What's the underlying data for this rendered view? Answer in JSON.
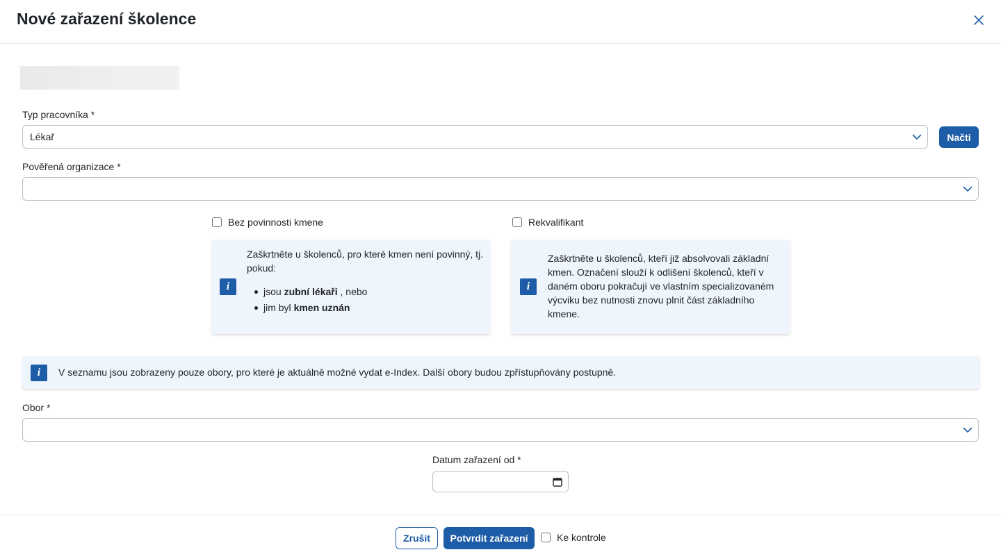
{
  "dialog": {
    "title": "Nové zařazení školence"
  },
  "form": {
    "worker_type": {
      "label": "Typ pracovníka *",
      "value": "Lékař",
      "load_button": "Načti"
    },
    "organization": {
      "label": "Pověřená organizace *",
      "value": ""
    },
    "no_trunk_duty": {
      "label": "Bez povinnosti kmene",
      "info_intro": "Zaškrtněte u školenců, pro které kmen není povinný, tj. pokud:",
      "bullet1_prefix": "jsou",
      "bullet1_bold": "zubní lékaři",
      "bullet1_suffix": ", nebo",
      "bullet2_prefix": "jim byl",
      "bullet2_bold": "kmen uznán"
    },
    "requalifier": {
      "label": "Rekvalifikant",
      "info": "Zaškrtněte u školenců, kteří již absolvovali základní kmen. Označení slouží k odlišení školenců, kteří v daném oboru pokračují ve vlastním specializovaném výcviku bez nutnosti znovu plnit část základního kmene."
    },
    "notice": "V seznamu jsou zobrazeny pouze obory, pro které je aktuálně možné vydat e-Index. Další obory budou zpřístupňovány postupně.",
    "field": {
      "label": "Obor *",
      "value": ""
    },
    "date_from": {
      "label": "Datum zařazení od *",
      "value": ""
    }
  },
  "footer": {
    "cancel": "Zrušit",
    "confirm": "Potvrdit zařazení",
    "to_review": "Ke kontrole"
  },
  "colors": {
    "primary": "#1d5ca6",
    "info_bg": "#eff5fc",
    "border": "#b9bfc6"
  }
}
